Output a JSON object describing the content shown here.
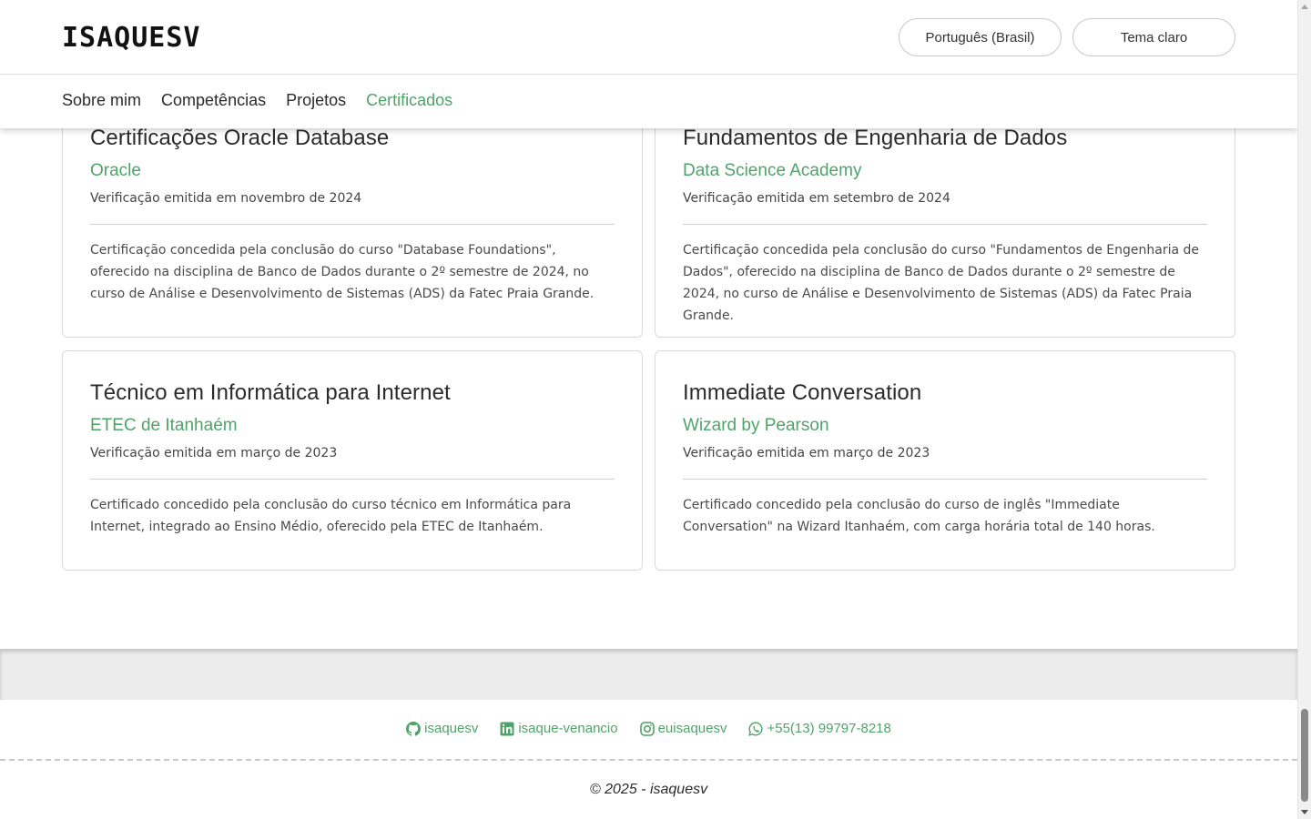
{
  "header": {
    "logo": "ISAQUESV",
    "language_button": "Português (Brasil)",
    "theme_button": "Tema claro",
    "nav": [
      "Sobre mim",
      "Competências",
      "Projetos",
      "Certificados"
    ]
  },
  "certificates": [
    {
      "title": "Certificações Oracle Database",
      "issuer": "Oracle",
      "date": "Verificação emitida em novembro de 2024",
      "description": "Certificação concedida pela conclusão do curso \"Database Foundations\", oferecido na disciplina de Banco de Dados durante o 2º semestre de 2024, no curso de Análise e Desenvolvimento de Sistemas (ADS) da Fatec Praia Grande."
    },
    {
      "title": "Fundamentos de Engenharia de Dados",
      "issuer": "Data Science Academy",
      "date": "Verificação emitida em setembro de 2024",
      "description": "Certificação concedida pela conclusão do curso \"Fundamentos de Engenharia de Dados\", oferecido na disciplina de Banco de Dados durante o 2º semestre de 2024, no curso de Análise e Desenvolvimento de Sistemas (ADS) da Fatec Praia Grande."
    },
    {
      "title": "Técnico em Informática para Internet",
      "issuer": "ETEC de Itanhaém",
      "date": "Verificação emitida em março de 2023",
      "description": "Certificado concedido pela conclusão do curso técnico em Informática para Internet, integrado ao Ensino Médio, oferecido pela ETEC de Itanhaém."
    },
    {
      "title": "Immediate Conversation",
      "issuer": "Wizard by Pearson",
      "date": "Verificação emitida em março de 2023",
      "description": "Certificado concedido pela conclusão do curso de inglês \"Immediate Conversation\" na Wizard Itanhaém, com carga horária total de 140 horas."
    }
  ],
  "footer": {
    "github": "isaquesv",
    "linkedin": "isaque-venancio",
    "instagram": "euisaquesv",
    "whatsapp": "+55(13) 99797-8218",
    "copyright": "© 2025 - isaquesv"
  },
  "colors": {
    "accent": "#4fa36a",
    "text": "#2b2b2b"
  }
}
